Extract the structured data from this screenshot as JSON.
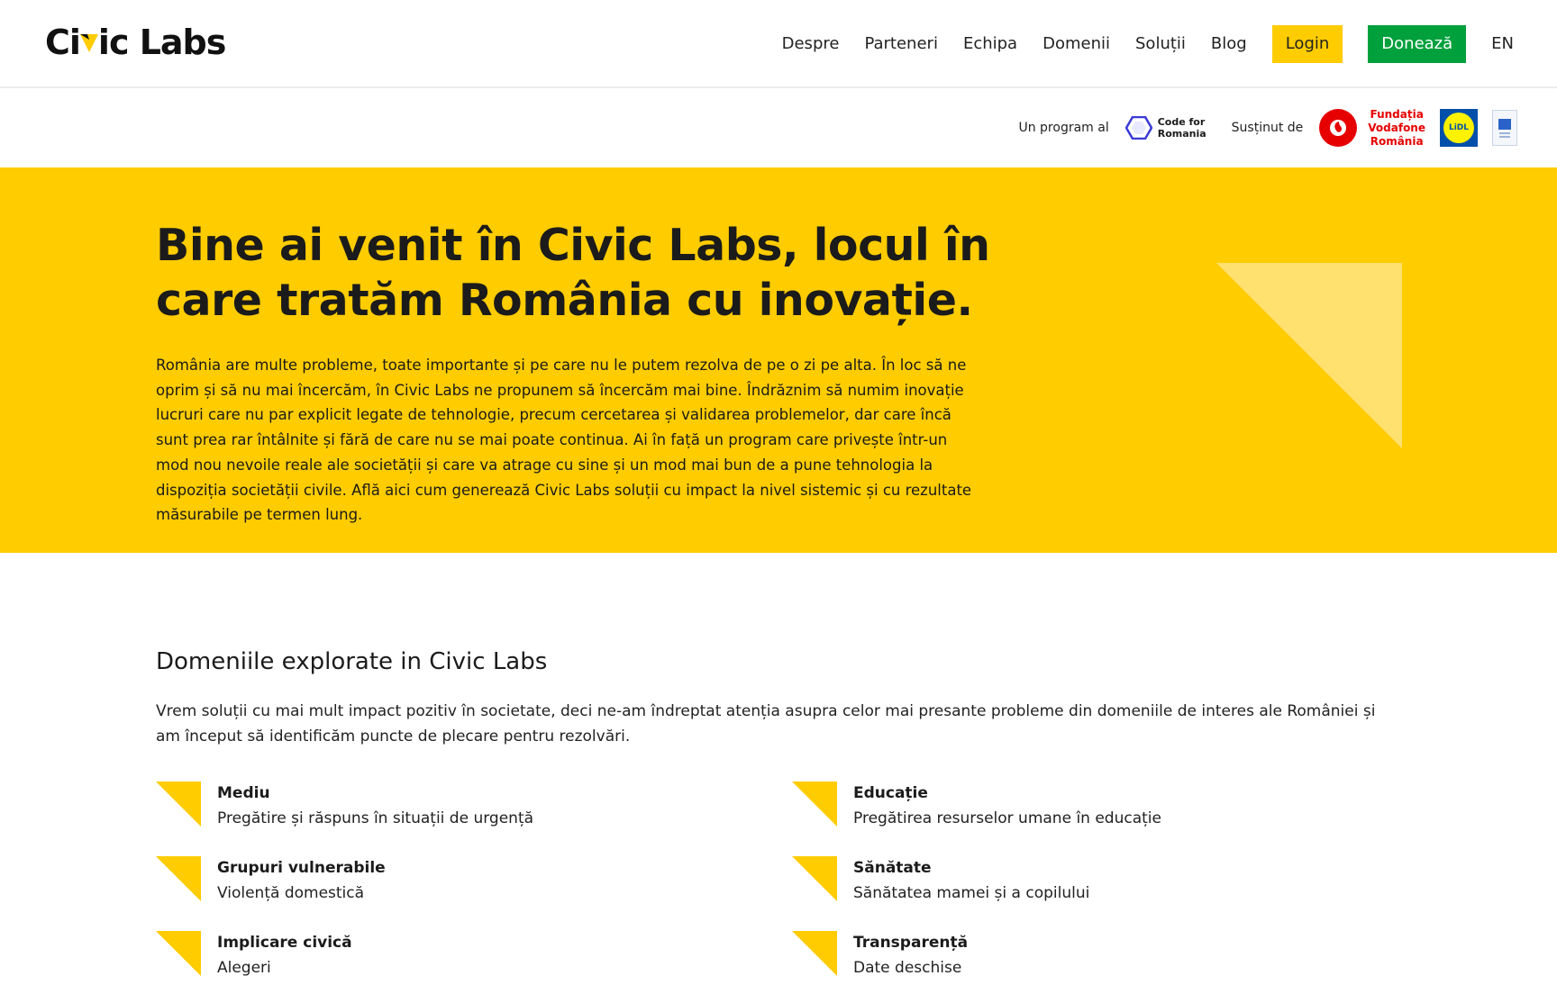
{
  "header": {
    "logo": {
      "part1": "Ci",
      "part2": "ic Labs"
    },
    "nav": [
      "Despre",
      "Parteneri",
      "Echipa",
      "Domenii",
      "Soluții",
      "Blog"
    ],
    "login_label": "Login",
    "donate_label": "Donează",
    "lang_label": "EN"
  },
  "partners": {
    "program_label": "Un program al",
    "cfr_line1": "Code for",
    "cfr_line2": "Romania",
    "supported_label": "Susținut de",
    "vodafone_line1": "Fundația",
    "vodafone_line2": "Vodafone",
    "vodafone_line3": "România",
    "lidl_label": "LiDL"
  },
  "hero": {
    "title": "Bine ai venit în Civic Labs, locul în care tratăm România cu inovație.",
    "text": "România are multe probleme, toate importante și pe care nu le putem rezolva de pe o zi pe alta. În loc să ne oprim și să nu mai încercăm, în Civic Labs ne propunem să încercăm mai bine. Îndrăznim să numim inovație lucruri care nu par explicit legate de tehnologie, precum cercetarea și validarea problemelor, dar care încă sunt prea rar întâlnite și fără de care nu se mai poate continua. Ai în față un program care privește într-un mod nou nevoile reale ale societății și care va atrage cu sine și un mod mai bun de a pune tehnologia la dispoziția societății civile. Află aici cum generează Civic Labs soluții cu impact la nivel sistemic și cu rezultate măsurabile pe termen lung."
  },
  "domains": {
    "heading": "Domeniile explorate in Civic Labs",
    "intro": "Vrem soluții cu mai mult impact pozitiv în societate, deci ne-am îndreptat atenția asupra celor mai presante probleme din domeniile de interes ale României și am început să identificăm puncte de plecare pentru rezolvări.",
    "items": [
      {
        "title": "Mediu",
        "subtitle": "Pregătire și răspuns în situații de urgență"
      },
      {
        "title": "Educație",
        "subtitle": "Pregătirea resurselor umane în educație"
      },
      {
        "title": "Grupuri vulnerabile",
        "subtitle": "Violență domestică"
      },
      {
        "title": "Sănătate",
        "subtitle": "Sănătatea mamei și a copilului"
      },
      {
        "title": "Implicare civică",
        "subtitle": "Alegeri"
      },
      {
        "title": "Transparență",
        "subtitle": "Date deschise"
      }
    ]
  },
  "colors": {
    "accent_yellow": "#ffcc00",
    "donate_green": "#00a03c",
    "vodafone_red": "#e60000",
    "text_dark": "#1b1b1b"
  }
}
